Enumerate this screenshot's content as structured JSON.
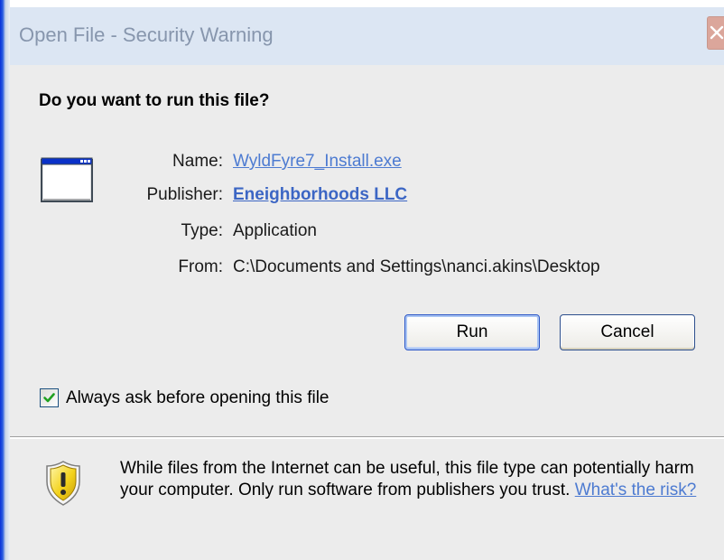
{
  "window": {
    "title": "Open File - Security Warning",
    "close_symbol": "✕"
  },
  "dialog": {
    "question": "Do you want to run this file?",
    "fields": {
      "name_label": "Name:",
      "name_value": "WyldFyre7_Install.exe",
      "publisher_label": "Publisher:",
      "publisher_value": "Eneighborhoods LLC",
      "type_label": "Type:",
      "type_value": "Application",
      "from_label": "From:",
      "from_value": "C:\\Documents and Settings\\nanci.akins\\Desktop"
    },
    "buttons": {
      "run_label": "Run",
      "cancel_label": "Cancel"
    },
    "checkbox": {
      "label": "Always ask before opening this file",
      "checked": true
    },
    "warning": {
      "text": "While files from the Internet can be useful, this file type can potentially harm your computer. Only run software from publishers you trust.",
      "link_label": "What's the risk?"
    }
  },
  "icons": {
    "app": "application-window-icon",
    "shield": "warning-shield-icon",
    "close": "close-icon",
    "check": "checkmark-icon"
  },
  "colors": {
    "link": "#4d7bd1",
    "publisher_link": "#3c66c4",
    "title_text": "#8796ad",
    "close_button": "#dba69b",
    "dialog_background": "#ececec"
  }
}
